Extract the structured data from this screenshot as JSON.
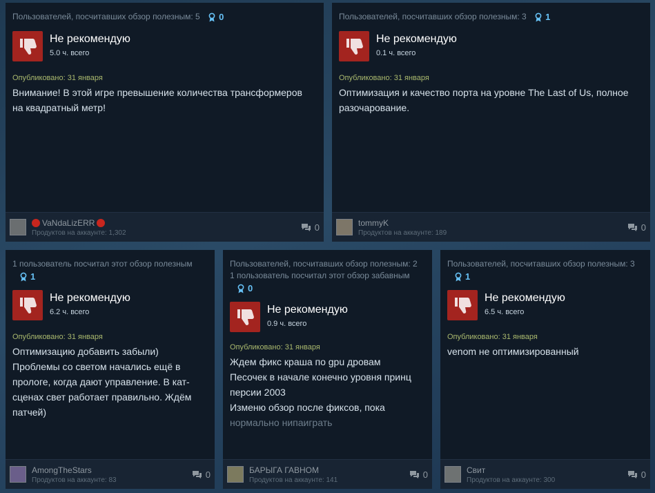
{
  "reviews": [
    {
      "helpful_text": "Пользователей, посчитавших обзор полезным: 5",
      "funny_text": "",
      "awards": "0",
      "verdict": "Не рекомендую",
      "hours": "5.0 ч. всего",
      "posted": "Опубликовано: 31 января",
      "body": [
        "Внимание! В этой игре превышение количества трансформеров на квадратный метр!"
      ],
      "body_faded": "",
      "username": "VaNdaLizERR",
      "products": "Продуктов на аккаунте: 1,302",
      "comments": "0"
    },
    {
      "helpful_text": "Пользователей, посчитавших обзор полезным: 3",
      "funny_text": "",
      "awards": "1",
      "verdict": "Не рекомендую",
      "hours": "0.1 ч. всего",
      "posted": "Опубликовано: 31 января",
      "body": [
        "Оптимизация и качество порта на уровне The Last of Us, полное разочарование."
      ],
      "body_faded": "",
      "username": "tommyK",
      "products": "Продуктов на аккаунте: 189",
      "comments": "0"
    },
    {
      "helpful_text": "1 пользователь посчитал этот обзор полезным",
      "funny_text": "",
      "awards": "1",
      "verdict": "Не рекомендую",
      "hours": "6.2 ч. всего",
      "posted": "Опубликовано: 31 января",
      "body": [
        "Оптимизацию добавить забыли)",
        "Проблемы со светом начались ещё в прологе, когда дают управление. В кат-сценах свет работает правильно. Ждём патчей)"
      ],
      "body_faded": "",
      "username": "AmongTheStars",
      "products": "Продуктов на аккаунте: 83",
      "comments": "0"
    },
    {
      "helpful_text": "Пользователей, посчитавших обзор полезным: 2",
      "funny_text": "1 пользователь посчитал этот обзор забавным",
      "awards": "0",
      "verdict": "Не рекомендую",
      "hours": "0.9 ч. всего",
      "posted": "Опубликовано: 31 января",
      "body": [
        "Ждем фикс краша по gpu дровам",
        "Песочек в начале конечно уровня принц персии 2003",
        "Изменю обзор после фиксов, пока"
      ],
      "body_faded": "нормально нипаиграть",
      "username": "БАРЫГА ГАВНОМ",
      "products": "Продуктов на аккаунте: 141",
      "comments": "0"
    },
    {
      "helpful_text": "Пользователей, посчитавших обзор полезным: 3",
      "funny_text": "",
      "awards": "1",
      "verdict": "Не рекомендую",
      "hours": "6.5 ч. всего",
      "posted": "Опубликовано: 31 января",
      "body": [
        "venom не оптимизированный"
      ],
      "body_faded": "",
      "username": "Свит",
      "products": "Продуктов на аккаунте: 300",
      "comments": "0"
    }
  ],
  "colors": {
    "thumb_bg": "#a3241f",
    "award": "#66c0f4",
    "posted": "#aab96e"
  },
  "icons": {
    "verdict": "thumbs-down-icon",
    "award": "award-ribbon-icon",
    "comments": "comment-bubble-icon"
  }
}
